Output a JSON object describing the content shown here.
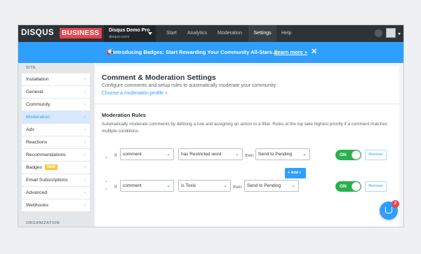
{
  "topbar": {
    "logo": "DISQUS",
    "business_badge": "BUSINESS",
    "site_name": "Disqus Demo Pro",
    "site_url": "disqus.com/",
    "nav": [
      "Start",
      "Analytics",
      "Moderation",
      "Settings",
      "Help"
    ],
    "active_nav": "Settings"
  },
  "banner": {
    "text": "Introducing Badges: Start Rewarding Your Community All-Stars✨",
    "link": "Learn more »",
    "close": "✕",
    "color": "#2e9fff"
  },
  "sidebar": {
    "heading": "SITE",
    "items": [
      {
        "label": "Installation"
      },
      {
        "label": "General"
      },
      {
        "label": "Community"
      },
      {
        "label": "Moderation",
        "active": true
      },
      {
        "label": "Ads"
      },
      {
        "label": "Reactions"
      },
      {
        "label": "Recommendations"
      },
      {
        "label": "Badges",
        "badge": "NEW"
      },
      {
        "label": "Email Subscriptions"
      },
      {
        "label": "Advanced"
      },
      {
        "label": "Webhooks"
      }
    ],
    "heading2": "ORGANIZATION"
  },
  "main": {
    "title": "Comment & Moderation Settings",
    "subtitle": "Configure comments and setup rules to automatically moderate your community.",
    "profile_link": "Choose a moderation profile »",
    "rules_title": "Moderation Rules",
    "rules_desc": "Automatically moderate comments by defining a rule and assigning an action to a filter. Rules at the top take highest priority if a comment matches multiple conditions.",
    "rules": [
      {
        "if_label": "If",
        "field": "comment",
        "condition": "has Restricted word",
        "then_label": "then",
        "action": "Send to Pending",
        "toggle": "ON",
        "remove": "Remove"
      },
      {
        "if_label": "If",
        "field": "comment",
        "condition": "is Toxic",
        "then_label": "then",
        "action": "Send to Pending",
        "toggle": "ON",
        "remove": "Remove"
      }
    ],
    "add_button": "+ Add r"
  },
  "chat": {
    "count": "2"
  },
  "colors": {
    "accent": "#2e9fff",
    "brand": "#e8434f",
    "toggle_on": "#28b04c",
    "topbar": "#2e3338"
  }
}
